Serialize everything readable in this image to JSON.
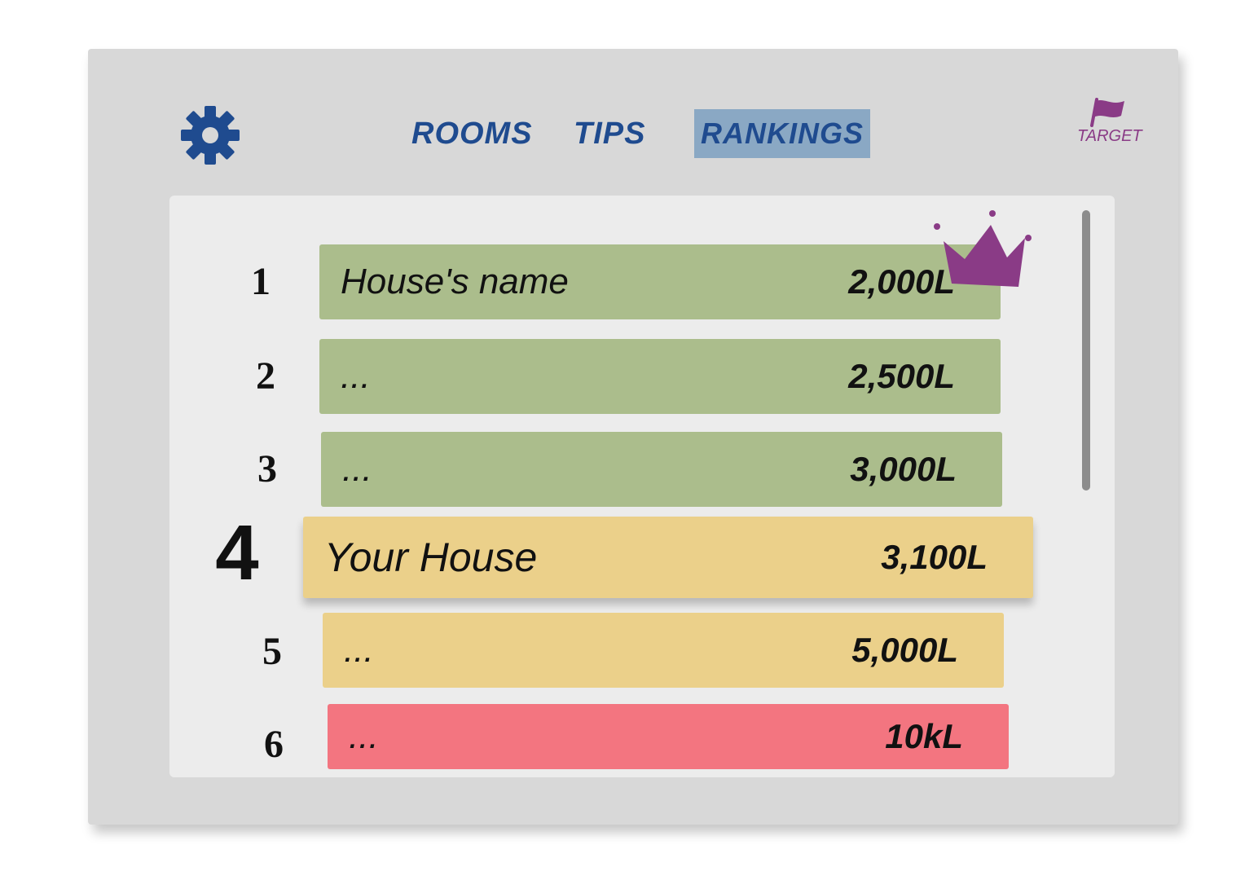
{
  "nav": {
    "tabs": [
      {
        "label": "ROOMS",
        "active": false
      },
      {
        "label": "TIPS",
        "active": false
      },
      {
        "label": "RANKINGS",
        "active": true
      }
    ],
    "target_label": "TARGET"
  },
  "rankings": [
    {
      "rank": "1",
      "name": "House's name",
      "value": "2,000L",
      "color": "green"
    },
    {
      "rank": "2",
      "name": "...",
      "value": "2,500L",
      "color": "green"
    },
    {
      "rank": "3",
      "name": "...",
      "value": "3,000L",
      "color": "green"
    },
    {
      "rank": "4",
      "name": "Your House",
      "value": "3,100L",
      "color": "yellow"
    },
    {
      "rank": "5",
      "name": "...",
      "value": "5,000L",
      "color": "yellow"
    },
    {
      "rank": "6",
      "name": "...",
      "value": "10kL",
      "color": "red"
    }
  ],
  "colors": {
    "green": "#abbd8c",
    "yellow": "#ebd08a",
    "red": "#f37580",
    "nav_text": "#1f4b8f",
    "active_tab": "#8aa8c4",
    "crown": "#8a3b86"
  },
  "icons": {
    "settings": "gear-icon",
    "target": "flag-icon",
    "top_rank": "crown-icon"
  }
}
